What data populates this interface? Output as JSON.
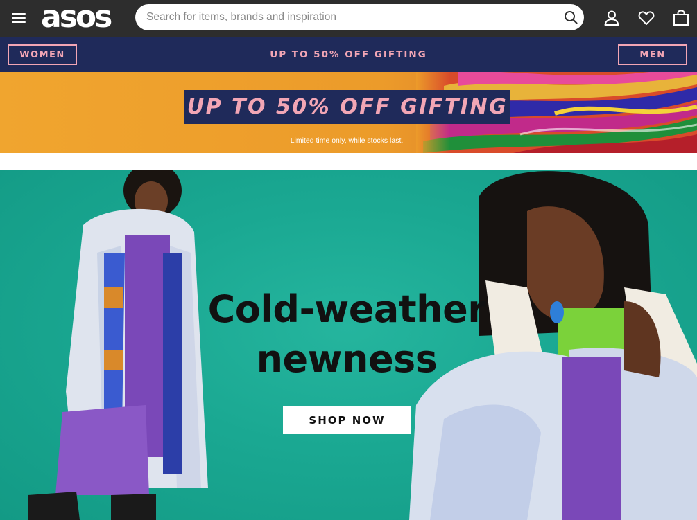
{
  "header": {
    "logo": "asos",
    "search_placeholder": "Search for items, brands and inspiration",
    "search_value": "",
    "icons": [
      "menu-icon",
      "search-icon",
      "account-icon",
      "heart-icon",
      "bag-icon"
    ]
  },
  "gender_bar": {
    "women_label": "WOMEN",
    "promo_link": "UP TO 50% OFF GIFTING",
    "men_label": "MEN"
  },
  "promo_banner": {
    "title": "UP TO 50% OFF GIFTING",
    "subtitle": "Limited time only, while stocks last."
  },
  "hero": {
    "title_line1": "Cold-weather",
    "title_line2": "newness",
    "cta_label": "SHOP NOW"
  },
  "colors": {
    "header_bg": "#2d2d2d",
    "gender_bar_bg": "#1f2a5a",
    "accent_pink": "#f2a6b5",
    "promo_orange": "#f0a52f",
    "hero_teal": "#1aa892"
  }
}
